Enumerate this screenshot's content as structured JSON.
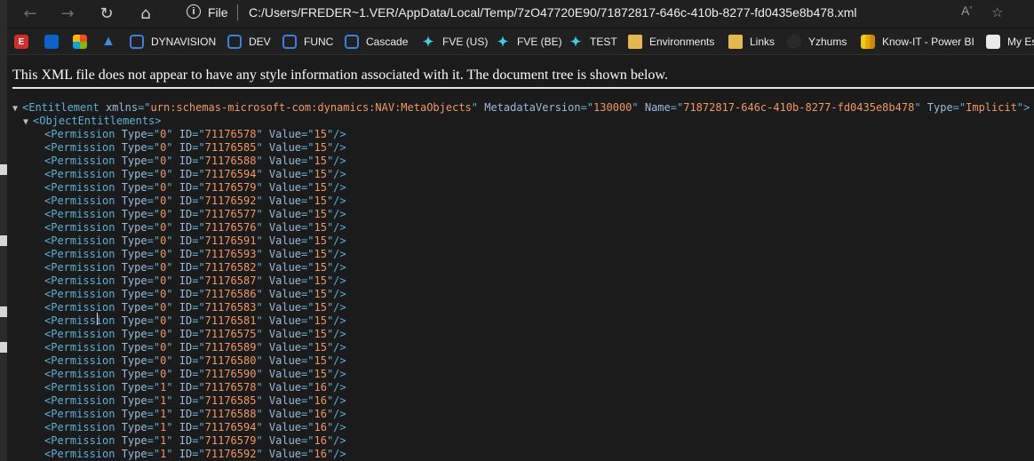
{
  "browser": {
    "address_scheme": "File",
    "address_url": "C:/Users/FREDER~1.VER/AppData/Local/Temp/7zO47720E90/71872817-646c-410b-8277-fd0435e8b478.xml",
    "icons": {
      "back": "back-arrow-icon",
      "forward": "forward-arrow-icon",
      "refresh": "refresh-icon",
      "home": "home-icon",
      "info": "info-icon",
      "read_aloud": "read-aloud-icon",
      "favorite": "add-favorite-icon"
    }
  },
  "favorites": [
    {
      "label": "",
      "icon": "E"
    },
    {
      "label": "",
      "icon": "ms"
    },
    {
      "label": "",
      "icon": "grid"
    },
    {
      "label": "",
      "icon": "azure"
    },
    {
      "label": "DYNAVISION",
      "icon": "d365"
    },
    {
      "label": "DEV",
      "icon": "d365"
    },
    {
      "label": "FUNC",
      "icon": "d365"
    },
    {
      "label": "Cascade",
      "icon": "d365"
    },
    {
      "label": "FVE (US)",
      "icon": "fve"
    },
    {
      "label": "FVE (BE)",
      "icon": "fve"
    },
    {
      "label": "TEST",
      "icon": "fve"
    },
    {
      "label": "Environments",
      "icon": "folder"
    },
    {
      "label": "Links",
      "icon": "folder"
    },
    {
      "label": "Yzhums",
      "icon": "dark"
    },
    {
      "label": "Know-IT - Power BI",
      "icon": "pbi"
    },
    {
      "label": "My Es",
      "icon": "doc"
    }
  ],
  "page": {
    "info_message": "This XML file does not appear to have any style information associated with it. The document tree is shown below."
  },
  "xml": {
    "root": {
      "tag": "Entitlement",
      "attributes": [
        {
          "name": "xmlns",
          "value": "urn:schemas-microsoft-com:dynamics:NAV:MetaObjects"
        },
        {
          "name": "MetadataVersion",
          "value": "130000"
        },
        {
          "name": "Name",
          "value": "71872817-646c-410b-8277-fd0435e8b478"
        },
        {
          "name": "Type",
          "value": "Implicit"
        }
      ]
    },
    "child_tag": "ObjectEntitlements",
    "permissions": [
      {
        "type": "0",
        "id": "71176578",
        "value": "15"
      },
      {
        "type": "0",
        "id": "71176585",
        "value": "15"
      },
      {
        "type": "0",
        "id": "71176588",
        "value": "15"
      },
      {
        "type": "0",
        "id": "71176594",
        "value": "15"
      },
      {
        "type": "0",
        "id": "71176579",
        "value": "15"
      },
      {
        "type": "0",
        "id": "71176592",
        "value": "15"
      },
      {
        "type": "0",
        "id": "71176577",
        "value": "15"
      },
      {
        "type": "0",
        "id": "71176576",
        "value": "15"
      },
      {
        "type": "0",
        "id": "71176591",
        "value": "15"
      },
      {
        "type": "0",
        "id": "71176593",
        "value": "15"
      },
      {
        "type": "0",
        "id": "71176582",
        "value": "15"
      },
      {
        "type": "0",
        "id": "71176587",
        "value": "15"
      },
      {
        "type": "0",
        "id": "71176586",
        "value": "15"
      },
      {
        "type": "0",
        "id": "71176583",
        "value": "15"
      },
      {
        "type": "0",
        "id": "71176581",
        "value": "15"
      },
      {
        "type": "0",
        "id": "71176575",
        "value": "15"
      },
      {
        "type": "0",
        "id": "71176589",
        "value": "15"
      },
      {
        "type": "0",
        "id": "71176580",
        "value": "15"
      },
      {
        "type": "0",
        "id": "71176590",
        "value": "15"
      },
      {
        "type": "1",
        "id": "71176578",
        "value": "16"
      },
      {
        "type": "1",
        "id": "71176585",
        "value": "16"
      },
      {
        "type": "1",
        "id": "71176588",
        "value": "16"
      },
      {
        "type": "1",
        "id": "71176594",
        "value": "16"
      },
      {
        "type": "1",
        "id": "71176579",
        "value": "16"
      },
      {
        "type": "1",
        "id": "71176592",
        "value": "16"
      }
    ]
  }
}
